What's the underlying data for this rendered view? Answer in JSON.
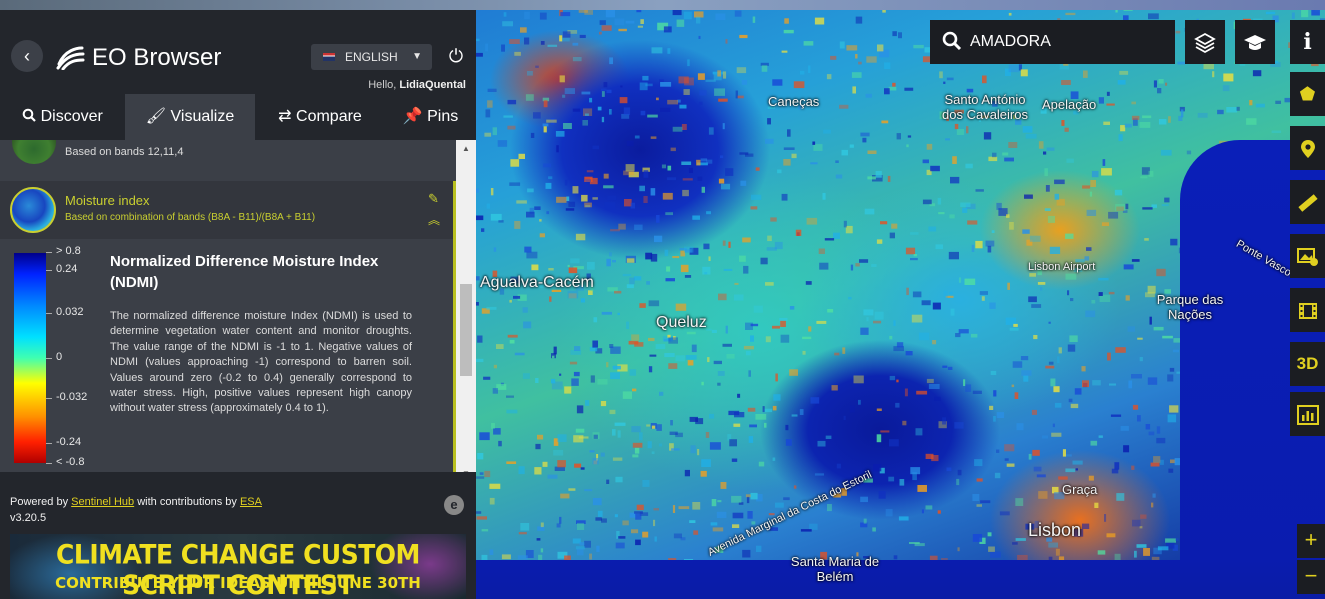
{
  "app": {
    "title": "EO Browser",
    "language": "ENGLISH",
    "hello_prefix": "Hello,",
    "username": "LidiaQuental"
  },
  "tabs": [
    {
      "label": "Discover",
      "icon": "search-icon"
    },
    {
      "label": "Visualize",
      "icon": "brush-icon",
      "active": true
    },
    {
      "label": "Compare",
      "icon": "swap-arrows-icon"
    },
    {
      "label": "Pins",
      "icon": "pin-icon"
    }
  ],
  "layers": {
    "previous_item": {
      "description": "Based on bands 12,11,4"
    },
    "selected_item": {
      "title": "Moisture index",
      "subtitle": "Based on combination of bands (B8A - B11)/(B8A + B11)"
    }
  },
  "legend": {
    "title": "Normalized Difference Moisture Index (NDMI)",
    "ticks": [
      "> 0.8",
      "0.24",
      "0.032",
      "0",
      "-0.032",
      "-0.24",
      "< -0.8"
    ],
    "description": "The normalized difference moisture Index (NDMI) is used to determine vegetation water content and monitor droughts. The value range of the NDMI is -1 to 1. Negative values of NDMI (values approaching -1) correspond to barren soil. Values around zero (-0.2 to 0.4) generally correspond to water stress. High, positive values represent high canopy without water stress (approximately 0.4 to 1)."
  },
  "footer": {
    "powered_by": "Powered by",
    "sentinel_hub": "Sentinel Hub",
    "contributions": "with contributions by",
    "esa": "ESA",
    "version": "v3.20.5",
    "banner_line1": "CLIMATE CHANGE CUSTOM SCRIPT CONTEST",
    "banner_line2": "CONTRIBUTE YOUR IDEAS UNTIL JUNE 30TH"
  },
  "search": {
    "value": "AMADORA"
  },
  "map_labels": {
    "canecas": "Caneças",
    "santo_antonio": "Santo António dos Cavaleiros",
    "apelacao": "Apelação",
    "agualva": "Agualva-Cacém",
    "queluz": "Queluz",
    "lisbon_airport": "Lisbon Airport",
    "parque_nacoes": "Parque das Nações",
    "ponte": "Ponte Vasco",
    "avenida": "Avenida Marginal da Costa do Estoril",
    "graca": "Graça",
    "lisbon": "Lisbon",
    "santa_maria": "Santa Maria de Belém"
  },
  "colors": {
    "accent": "#c9cf30",
    "panel_bg": "#3b3f47",
    "header_bg": "#23262c"
  }
}
